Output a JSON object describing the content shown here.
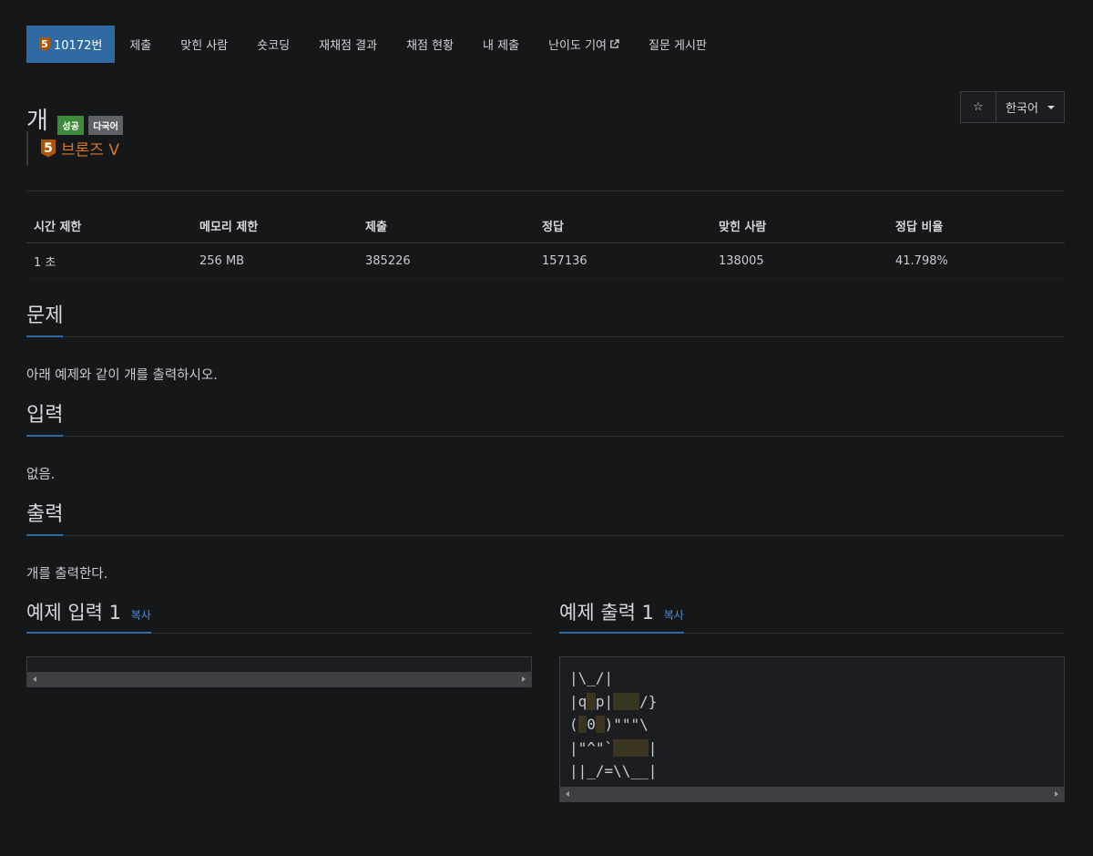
{
  "nav": {
    "problem_id": "10172번",
    "tier_number": "5",
    "items": [
      "제출",
      "맞힌 사람",
      "숏코딩",
      "재채점 결과",
      "채점 현황",
      "내 제출",
      "난이도 기여",
      "질문 게시판"
    ]
  },
  "problem": {
    "title": "개",
    "labels": [
      "성공",
      "다국어"
    ],
    "tier_number": "5",
    "tier_text": "브론즈 V",
    "star_icon": "☆",
    "language": "한국어"
  },
  "info": {
    "headers": [
      "시간 제한",
      "메모리 제한",
      "제출",
      "정답",
      "맞힌 사람",
      "정답 비율"
    ],
    "values": [
      "1 초",
      "256 MB",
      "385226",
      "157136",
      "138005",
      "41.798%"
    ]
  },
  "sections": {
    "description_title": "문제",
    "description": "아래 예제와 같이 개를 출력하시오.",
    "input_title": "입력",
    "input": "없음.",
    "output_title": "출력",
    "output": "개를 출력한다."
  },
  "samples": {
    "input_title": "예제 입력 1",
    "output_title": "예제 출력 1",
    "copy_label": "복사",
    "input_text": "",
    "output_lines": [
      "|\\_/|",
      "|q p|   /}",
      "( 0 )\"\"\"\\",
      "|\"^\"`    |",
      "||_/=\\\\__|"
    ]
  },
  "colors": {
    "background": "#161719",
    "accent": "#2f6aa3",
    "success": "#3c8a3a",
    "tier_bronze": "#ad5600"
  }
}
